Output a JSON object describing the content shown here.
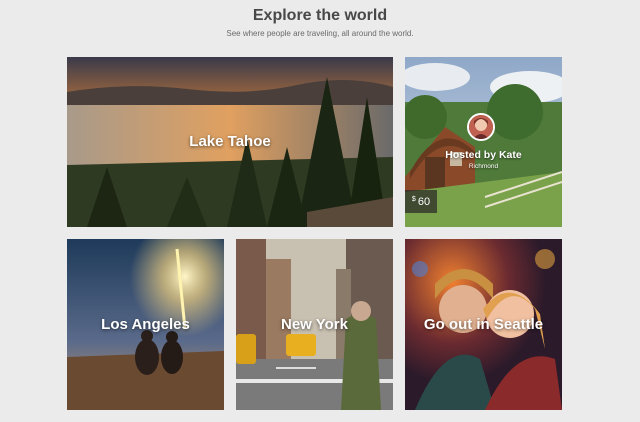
{
  "header": {
    "title": "Explore the world",
    "subtitle": "See where people are traveling, all around the world."
  },
  "cards": {
    "tahoe": {
      "label": "Lake Tahoe"
    },
    "host": {
      "host_label": "Hosted by Kate",
      "location": "Richmond",
      "price_currency": "$",
      "price_value": "60"
    },
    "la": {
      "label": "Los Angeles"
    },
    "ny": {
      "label": "New York"
    },
    "seattle": {
      "label": "Go out in Seattle"
    }
  }
}
